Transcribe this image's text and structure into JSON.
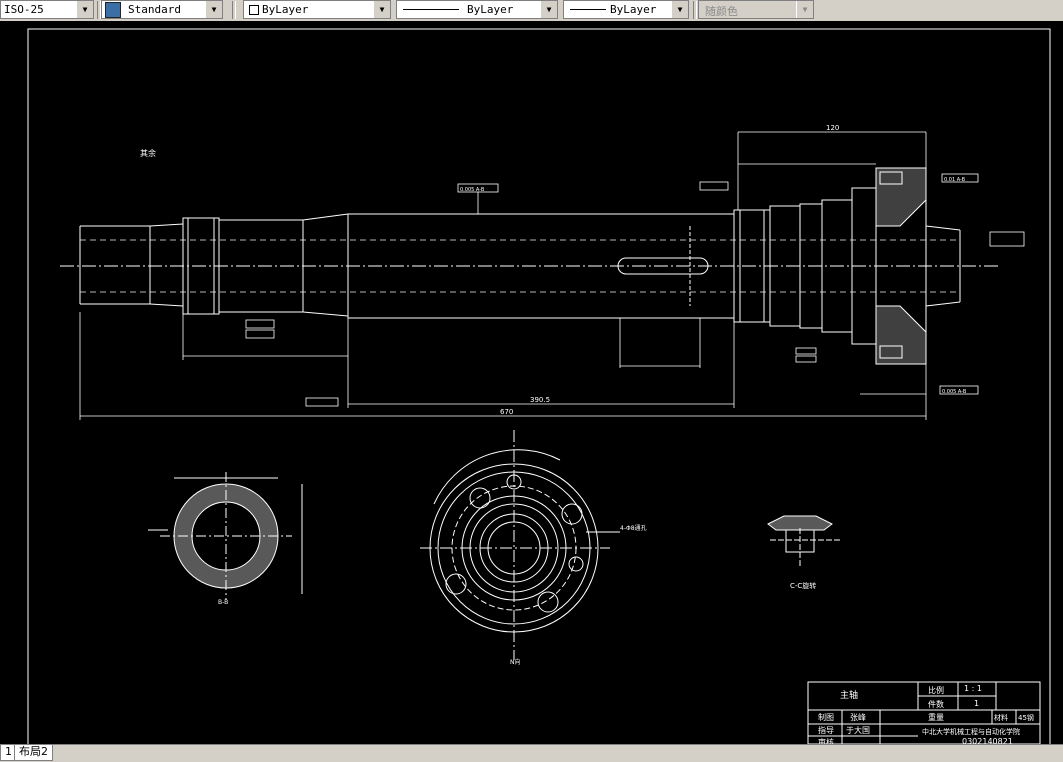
{
  "toolbar": {
    "dimstyle": "ISO-25",
    "textstyle": "Standard",
    "layer": "ByLayer",
    "linetype": "ByLayer",
    "lineweight": "ByLayer",
    "color": "随颜色"
  },
  "drawing": {
    "roughness_note": "其余 ",
    "section_label": "C-C旋转",
    "view_label": "B-B",
    "detail_label": "N向",
    "dim_total": "670",
    "dim_mid": "390.5",
    "dim_right": "120",
    "holes_note": "4-Φ8通孔",
    "tol_1": "0.005 A-B",
    "tol_2": "0.01 A-B",
    "tol_3": "0.005 A-B"
  },
  "title_block": {
    "part_name": "主轴",
    "scale_label": "比例",
    "scale_value": "1 : 1",
    "qty_label": "件数",
    "qty_value": "1",
    "weight_label": "重量",
    "material_label": "材料",
    "material_value": "45钢",
    "drawn_label": "制图",
    "drawn_name": "张峰",
    "guide_label": "指导",
    "guide_name": "于大国",
    "review_label": "审核",
    "school": "中北大学机械工程与自动化学院",
    "drawing_no": "0302140821"
  },
  "tabs": {
    "layout1": "1",
    "layout2": "布局2"
  },
  "colors": {
    "background": "#000000",
    "line": "#ffffff",
    "toolbar": "#d4d0c8"
  }
}
